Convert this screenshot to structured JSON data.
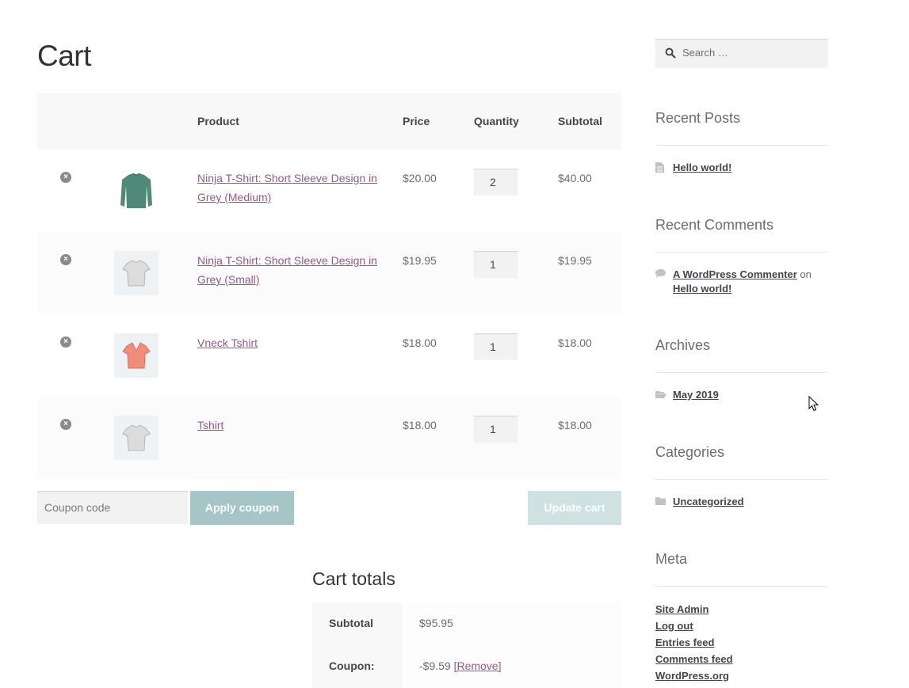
{
  "page": {
    "title": "Cart"
  },
  "cart": {
    "headers": {
      "product": "Product",
      "price": "Price",
      "quantity": "Quantity",
      "subtotal": "Subtotal"
    },
    "items": [
      {
        "name": "Ninja T-Shirt: Short Sleeve Design in Grey (Medium)",
        "price": "$20.00",
        "qty": "2",
        "subtotal": "$40.00",
        "thumb": "green-sweater"
      },
      {
        "name": "Ninja T-Shirt: Short Sleeve Design in Grey (Small)",
        "price": "$19.95",
        "qty": "1",
        "subtotal": "$19.95",
        "thumb": "grey-tshirt"
      },
      {
        "name": "Vneck Tshirt",
        "price": "$18.00",
        "qty": "1",
        "subtotal": "$18.00",
        "thumb": "coral-vneck"
      },
      {
        "name": "Tshirt",
        "price": "$18.00",
        "qty": "1",
        "subtotal": "$18.00",
        "thumb": "grey-tshirt"
      }
    ],
    "remove_symbol": "×",
    "coupon_placeholder": "Coupon code",
    "apply_label": "Apply coupon",
    "update_label": "Update cart"
  },
  "totals": {
    "title": "Cart totals",
    "subtotal_label": "Subtotal",
    "subtotal_value": "$95.95",
    "coupon_label": "Coupon:",
    "coupon_value": "-$9.59",
    "coupon_remove": "[Remove]"
  },
  "sidebar": {
    "search_placeholder": "Search …",
    "recent_posts": {
      "title": "Recent Posts",
      "items": [
        "Hello world!"
      ]
    },
    "recent_comments": {
      "title": "Recent Comments",
      "author": "A WordPress Commenter",
      "on": "on",
      "post": "Hello world!"
    },
    "archives": {
      "title": "Archives",
      "items": [
        "May 2019"
      ]
    },
    "categories": {
      "title": "Categories",
      "items": [
        "Uncategorized"
      ]
    },
    "meta": {
      "title": "Meta",
      "items": [
        "Site Admin",
        "Log out",
        "Entries feed",
        "Comments feed",
        "WordPress.org"
      ]
    }
  },
  "colors": {
    "link": "#96588a",
    "button": "#a5c5c6",
    "button_disabled": "#cfe1e1"
  }
}
